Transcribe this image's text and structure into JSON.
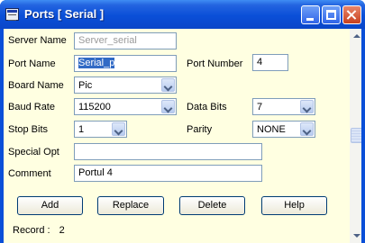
{
  "window": {
    "title": "Ports [ Serial ]"
  },
  "form": {
    "server_name": {
      "label": "Server Name",
      "value": "Server_serial"
    },
    "port_name": {
      "label": "Port Name",
      "value": "Serial_p"
    },
    "port_number": {
      "label": "Port Number",
      "value": "4"
    },
    "board_name": {
      "label": "Board Name",
      "value": "Pic"
    },
    "baud_rate": {
      "label": "Baud Rate",
      "value": "115200"
    },
    "data_bits": {
      "label": "Data Bits",
      "value": "7"
    },
    "stop_bits": {
      "label": "Stop Bits",
      "value": "1"
    },
    "parity": {
      "label": "Parity",
      "value": "NONE"
    },
    "special_opt": {
      "label": "Special Opt",
      "value": ""
    },
    "comment": {
      "label": "Comment",
      "value": "Portul 4"
    }
  },
  "buttons": {
    "add": "Add",
    "replace": "Replace",
    "delete": "Delete",
    "help": "Help"
  },
  "status": {
    "record_label": "Record :",
    "record_count": "2"
  },
  "colors": {
    "titlebar": "#0a4fd8",
    "client_background": "#ffffe1",
    "selection": "#316ac5"
  },
  "icons": [
    "app-window-icon",
    "minimize-icon",
    "maximize-icon",
    "close-icon",
    "chevron-down-icon",
    "scroll-up-icon",
    "scroll-down-icon"
  ]
}
